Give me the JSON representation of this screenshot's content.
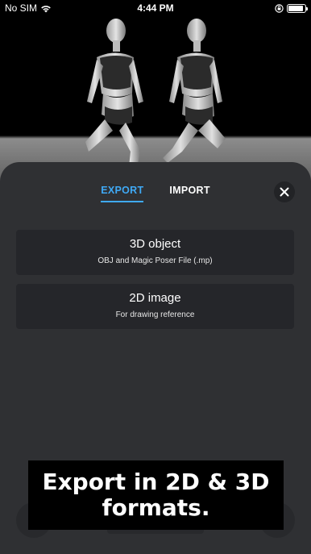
{
  "status_bar": {
    "carrier": "No SIM",
    "time": "4:44 PM",
    "battery_level": 0.9
  },
  "tabs": [
    {
      "label": "EXPORT",
      "active": true
    },
    {
      "label": "IMPORT",
      "active": false
    }
  ],
  "options": [
    {
      "title": "3D object",
      "subtitle": "OBJ and Magic Poser File (.mp)"
    },
    {
      "title": "2D image",
      "subtitle": "For drawing reference"
    }
  ],
  "banner": {
    "text": "Export in 2D & 3D\nformats."
  },
  "colors": {
    "accent": "#3fa9f5",
    "sheet_bg": "#2f3033",
    "option_bg": "#25262a"
  },
  "icons": [
    "wifi-icon",
    "orientation-lock-icon",
    "battery-icon",
    "close-icon"
  ]
}
